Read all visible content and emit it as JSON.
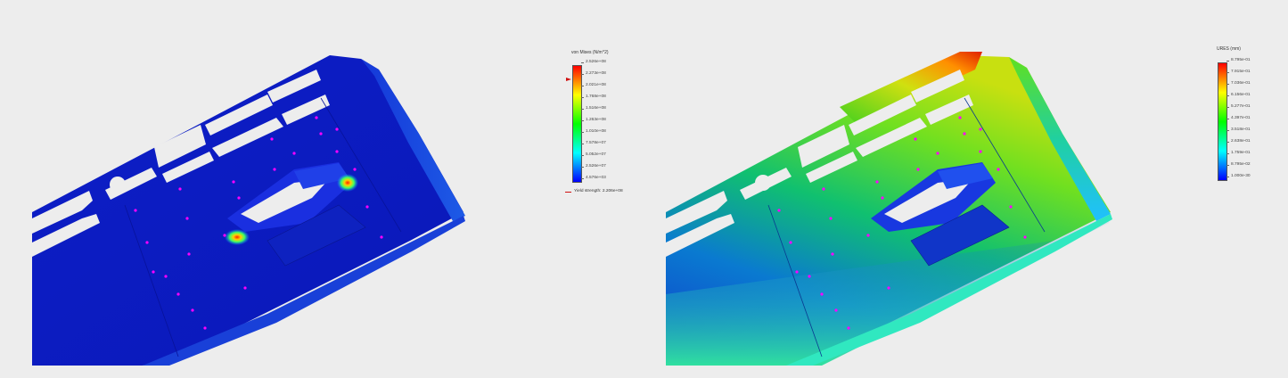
{
  "stress_view": {
    "legend": {
      "title": "von Mises (N/m^2)",
      "ticks": [
        "2.526e+08",
        "2.273e+08",
        "2.021e+08",
        "1.768e+08",
        "1.516e+08",
        "1.263e+08",
        "1.010e+08",
        "7.578e+07",
        "5.052e+07",
        "2.526e+07",
        "4.576e+03"
      ],
      "yield_label": "Yield strength: 2.206e+08"
    }
  },
  "displacement_view": {
    "legend": {
      "title": "URES (mm)",
      "ticks": [
        "8.795e-01",
        "7.915e-01",
        "7.036e-01",
        "6.156e-01",
        "5.277e-01",
        "4.397e-01",
        "3.518e-01",
        "2.638e-01",
        "1.759e-01",
        "8.795e-02",
        "1.000e-30"
      ]
    }
  },
  "colors": {
    "background": "#ededed",
    "scale": [
      "#ff0000",
      "#ff8000",
      "#ffff00",
      "#80ff00",
      "#00ff00",
      "#00ff80",
      "#00ffff",
      "#0080ff",
      "#0000ff"
    ],
    "fixture_markers": "#ff00ff"
  }
}
